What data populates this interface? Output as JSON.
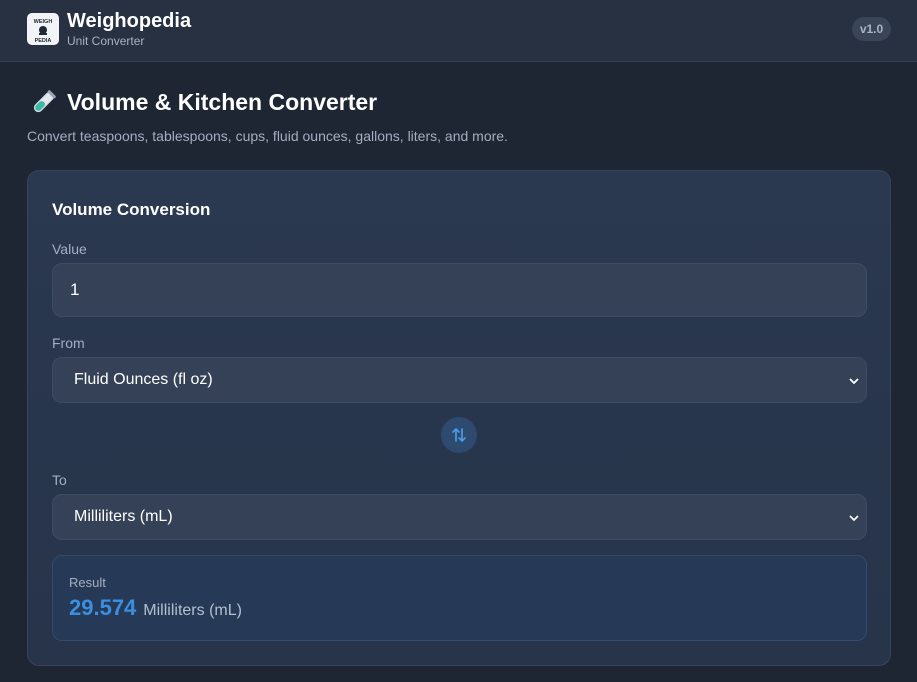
{
  "header": {
    "logo_text_top": "WEIGH",
    "logo_text_bottom": "PEDIA",
    "title": "Weighopedia",
    "subtitle": "Unit Converter",
    "version": "v1.0"
  },
  "page": {
    "icon": "test-tube-icon",
    "title": "Volume & Kitchen Converter",
    "description": "Convert teaspoons, tablespoons, cups, fluid ounces, gallons, liters, and more."
  },
  "converter": {
    "card_title": "Volume Conversion",
    "value_label": "Value",
    "value": "1",
    "from_label": "From",
    "from_selected": "Fluid Ounces (fl oz)",
    "to_label": "To",
    "to_selected": "Milliliters (mL)",
    "result_label": "Result",
    "result_value": "29.574",
    "result_unit": "Milliliters (mL)"
  },
  "colors": {
    "accent": "#3b8fe0",
    "background": "#1e2634",
    "card": "#2a3850"
  }
}
